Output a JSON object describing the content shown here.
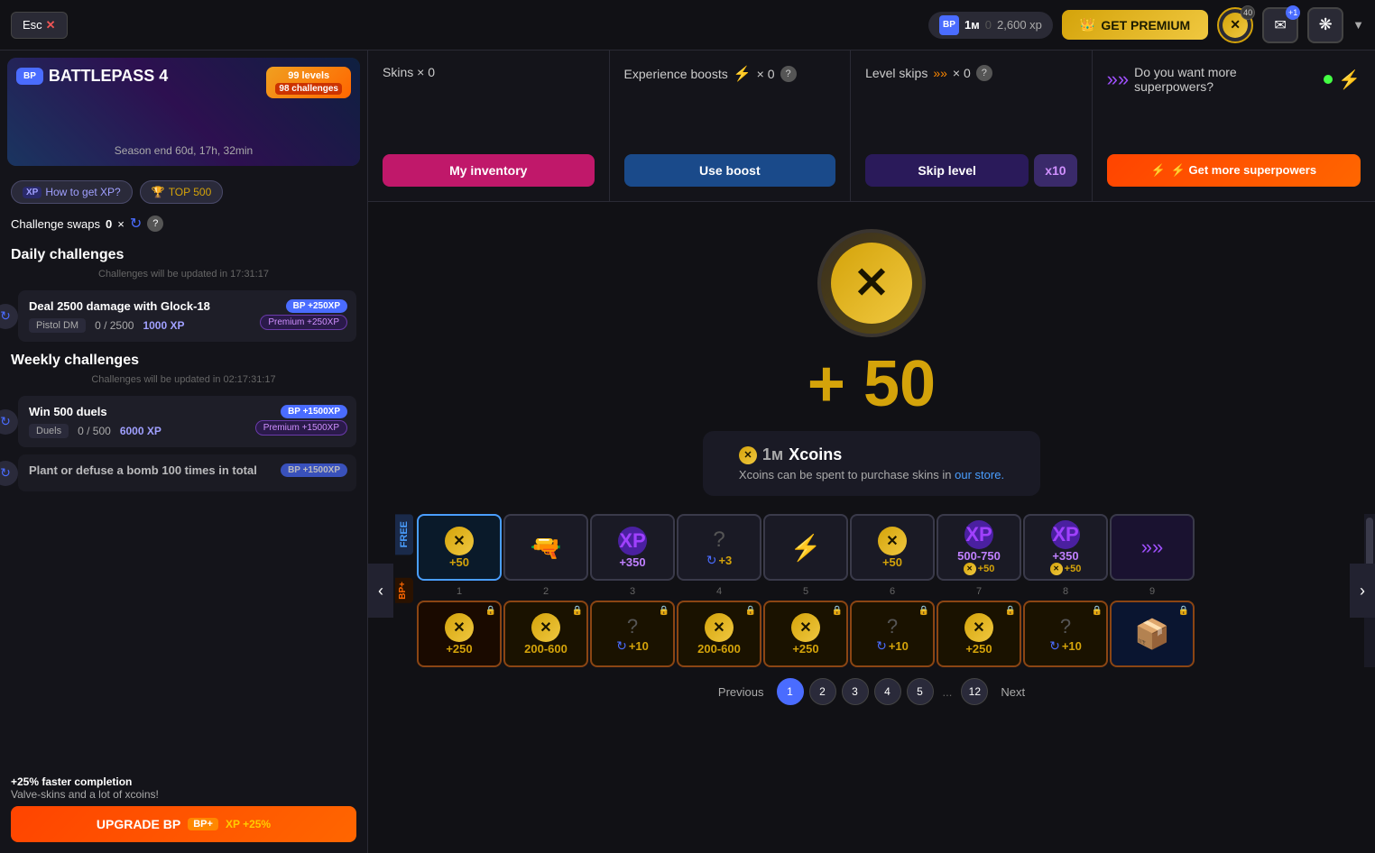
{
  "topNav": {
    "esc_label": "Esc",
    "x_label": "✕",
    "currency": {
      "bp_label": "BP",
      "amount": "1м",
      "separator": "0",
      "xp": "2,600 xp"
    },
    "get_premium": "GET PREMIUM",
    "crown": "👑",
    "xcoin_count": "40",
    "notif_count": "+1",
    "dropdown": "▼"
  },
  "sidebar": {
    "battlepass_label": "BP",
    "battlepass_title": "BATTLEPASS 4",
    "levels_badge": "99 levels",
    "challenges_badge": "98 challenges",
    "season_end": "Season end 60d, 17h,  32min",
    "how_to_xp": "XP How to get XP?",
    "top500": "TOP 500",
    "challenge_swaps_label": "Challenge swaps",
    "challenge_swaps_count": "0",
    "daily_title": "Daily challenges",
    "daily_update": "Challenges will be updated in 17:31:17",
    "challenge1_title": "Deal 2500 damage with Glock-18",
    "challenge1_mode": "Pistol DM",
    "challenge1_progress": "0 / 2500",
    "challenge1_xp": "1000  XP",
    "challenge1_bp": "BP +250XP",
    "challenge1_premium": "Premium +250XP",
    "weekly_title": "Weekly challenges",
    "weekly_update": "Challenges will be updated in 02:17:31:17",
    "challenge2_title": "Win 500 duels",
    "challenge2_mode": "Duels",
    "challenge2_progress": "0 / 500",
    "challenge2_xp": "6000  XP",
    "challenge2_bp": "BP +1500XP",
    "challenge2_premium": "Premium +1500XP",
    "challenge3_title": "Plant or defuse a bomb 100 times in total",
    "upgrade_text1": "+25% faster completion",
    "upgrade_text2": "Valve-skins and a lot of xcoins!",
    "upgrade_btn": "UPGRADE BP",
    "upgrade_bp_plus": "BP+",
    "upgrade_xp": "XP +25%"
  },
  "panels": {
    "skins_label": "Skins × 0",
    "my_inventory": "My inventory",
    "exp_boosts_label": "Experience boosts",
    "exp_count": "× 0",
    "use_boost": "Use boost",
    "level_skips_label": "Level skips",
    "level_skips_count": "× 0",
    "skip_level": "Skip level",
    "x10": "x10",
    "superpowers_label": "Do you want more superpowers?",
    "get_superpowers": "⚡ Get more superpowers"
  },
  "reward": {
    "plus50": "+ 50",
    "title": "Xcoins",
    "amount_label": "1м",
    "desc": "Xcoins can be spent to purchase skins in",
    "store_link": "our store."
  },
  "track": {
    "free_label": "FREE",
    "bpplus_label": "BP+",
    "cards_free": [
      {
        "id": 1,
        "type": "xcoin",
        "value": "+50",
        "active": true
      },
      {
        "id": 2,
        "type": "skin",
        "value": ""
      },
      {
        "id": 3,
        "type": "xp",
        "value": "+350"
      },
      {
        "id": 4,
        "type": "mystery",
        "value": "+3"
      },
      {
        "id": 5,
        "type": "lightning",
        "value": ""
      },
      {
        "id": 6,
        "type": "xcoin",
        "value": "+50"
      },
      {
        "id": 7,
        "type": "xp_xcoin",
        "value": "500-750",
        "sub": "+50"
      },
      {
        "id": 8,
        "type": "xp_xcoin",
        "value": "+350",
        "sub": "+50"
      },
      {
        "id": 9,
        "type": "arrows",
        "value": ""
      }
    ],
    "cards_premium": [
      {
        "id": 1,
        "type": "xcoin",
        "value": "+250"
      },
      {
        "id": 2,
        "type": "xcoin_range",
        "value": "200-600"
      },
      {
        "id": 3,
        "type": "mystery_xcoin",
        "value": "+10"
      },
      {
        "id": 4,
        "type": "xcoin_range",
        "value": "200-600"
      },
      {
        "id": 5,
        "type": "xcoin",
        "value": "+250"
      },
      {
        "id": 6,
        "type": "mystery_xcoin",
        "value": "+10"
      },
      {
        "id": 7,
        "type": "xcoin",
        "value": "+250"
      },
      {
        "id": 8,
        "type": "mystery_xcoin",
        "value": "+10"
      },
      {
        "id": 9,
        "type": "chest",
        "value": ""
      }
    ],
    "nums": [
      "1",
      "2",
      "3",
      "4",
      "5",
      "6",
      "7",
      "8",
      "9"
    ]
  },
  "pagination": {
    "prev": "Previous",
    "pages": [
      "1",
      "2",
      "3",
      "4",
      "5",
      "...",
      "12"
    ],
    "next": "Next",
    "current": "1"
  }
}
